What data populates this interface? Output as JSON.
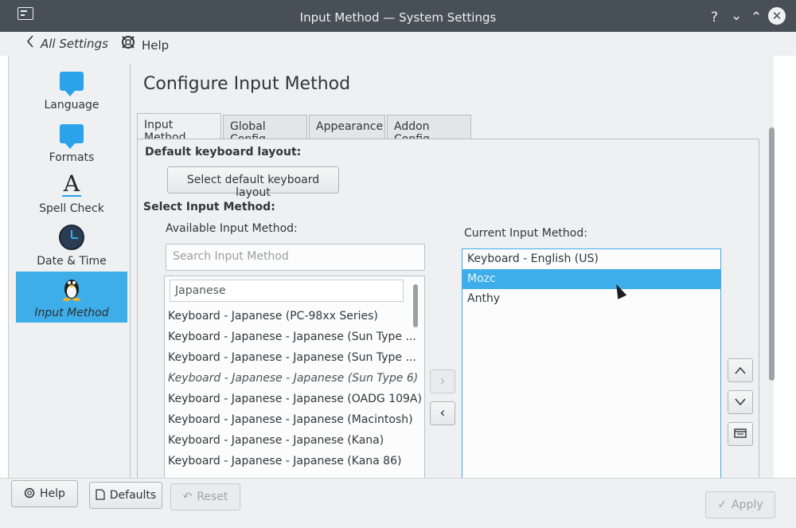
{
  "window": {
    "title": "Input Method — System Settings",
    "controls": {
      "help": "?",
      "minimize": "⌄",
      "maximize": "⌃",
      "close": "✕"
    }
  },
  "topbar": {
    "back_label": "All Settings",
    "help_label": "Help"
  },
  "sidebar": {
    "items": [
      {
        "label": "Language",
        "icon": "language-icon"
      },
      {
        "label": "Formats",
        "icon": "formats-icon"
      },
      {
        "label": "Spell Check",
        "icon": "spell-check-icon"
      },
      {
        "label": "Date & Time",
        "icon": "clock-icon"
      },
      {
        "label": "Input Method",
        "icon": "tux-icon",
        "active": true
      }
    ]
  },
  "content": {
    "title": "Configure Input Method",
    "tabs": [
      "Input Method",
      "Global Config",
      "Appearance",
      "Addon Config"
    ],
    "active_tab": "Input Method",
    "default_layout_label": "Default keyboard layout:",
    "select_default_button": "Select default keyboard layout",
    "select_method_label": "Select Input Method:",
    "available_label": "Available Input Method:",
    "search_placeholder": "Search Input Method",
    "filter_value": "Japanese",
    "available_items": [
      "Keyboard - Japanese (PC-98xx Series)",
      "Keyboard - Japanese - Japanese (Sun Type ...",
      "Keyboard - Japanese - Japanese (Sun Type ...",
      "Keyboard - Japanese - Japanese (Sun Type 6)",
      "Keyboard - Japanese - Japanese (OADG 109A)",
      "Keyboard - Japanese - Japanese (Macintosh)",
      "Keyboard - Japanese - Japanese (Kana)",
      "Keyboard - Japanese - Japanese (Kana 86)"
    ],
    "current_label": "Current Input Method:",
    "current_items": [
      "Keyboard - English (US)",
      "Mozc",
      "Anthy"
    ],
    "selected_current": "Mozc"
  },
  "bottom": {
    "help": "Help",
    "defaults": "Defaults",
    "reset": "Reset",
    "apply": "Apply"
  },
  "colors": {
    "accent": "#3daee9",
    "titlebar": "#475057",
    "window_bg": "#eff0f1"
  }
}
